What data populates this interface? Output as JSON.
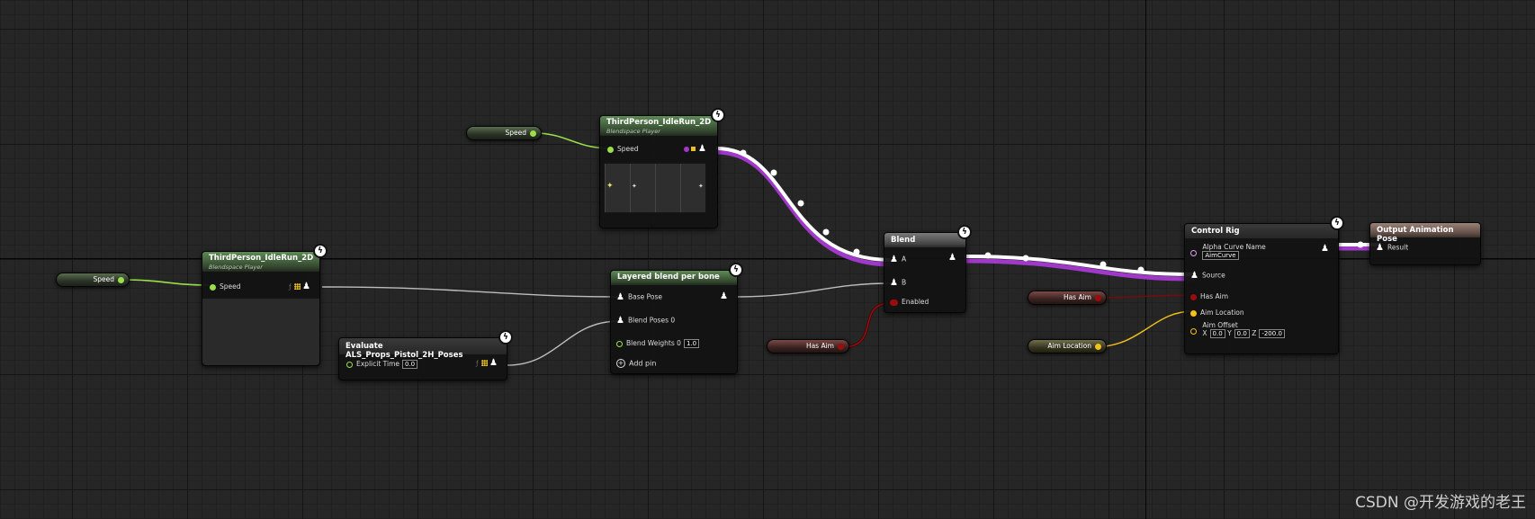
{
  "nodes": {
    "blendspace_top": {
      "title": "ThirdPerson_IdleRun_2D",
      "subtitle": "Blendspace Player",
      "speed_pin": "Speed"
    },
    "blendspace_left": {
      "title": "ThirdPerson_IdleRun_2D",
      "subtitle": "Blendspace Player",
      "speed_pin": "Speed"
    },
    "evaluate": {
      "title": "Evaluate ALS_Props_Pistol_2H_Poses",
      "explicit_time_label": "Explicit Time",
      "explicit_time_value": "0.0"
    },
    "layered": {
      "title": "Layered blend per bone",
      "base_pose": "Base Pose",
      "blend_poses": "Blend Poses 0",
      "blend_weights": "Blend Weights 0",
      "blend_weights_value": "1.0",
      "add_pin": "Add pin"
    },
    "blend": {
      "title": "Blend",
      "pin_a": "A",
      "pin_b": "B",
      "enabled": "Enabled"
    },
    "control_rig": {
      "title": "Control Rig",
      "alpha_curve_name": "Alpha Curve Name",
      "alpha_curve_value": "AimCurve",
      "source": "Source",
      "has_aim": "Has Aim",
      "aim_location": "Aim Location",
      "aim_offset": "Aim Offset",
      "x_label": "X",
      "x_value": "0.0",
      "y_label": "Y",
      "y_value": "0.0",
      "z_label": "Z",
      "z_value": "-200.0"
    },
    "output": {
      "title": "Output Animation Pose",
      "result": "Result"
    }
  },
  "variables": {
    "speed_top": "Speed",
    "speed_left": "Speed",
    "has_aim_mid": "Has Aim",
    "has_aim_right": "Has Aim",
    "aim_location": "Aim Location"
  },
  "icons": {
    "bolt": "lightning-icon",
    "pose": "mannequin-icon"
  },
  "colors": {
    "float_pin": "#9adf4a",
    "bool_pin": "#9b0d0d",
    "vector_pin": "#f2c21a",
    "pose_wire": "#ffffff",
    "exec_wire_glow": "#a038c8"
  },
  "watermark": "CSDN @开发游戏的老王"
}
